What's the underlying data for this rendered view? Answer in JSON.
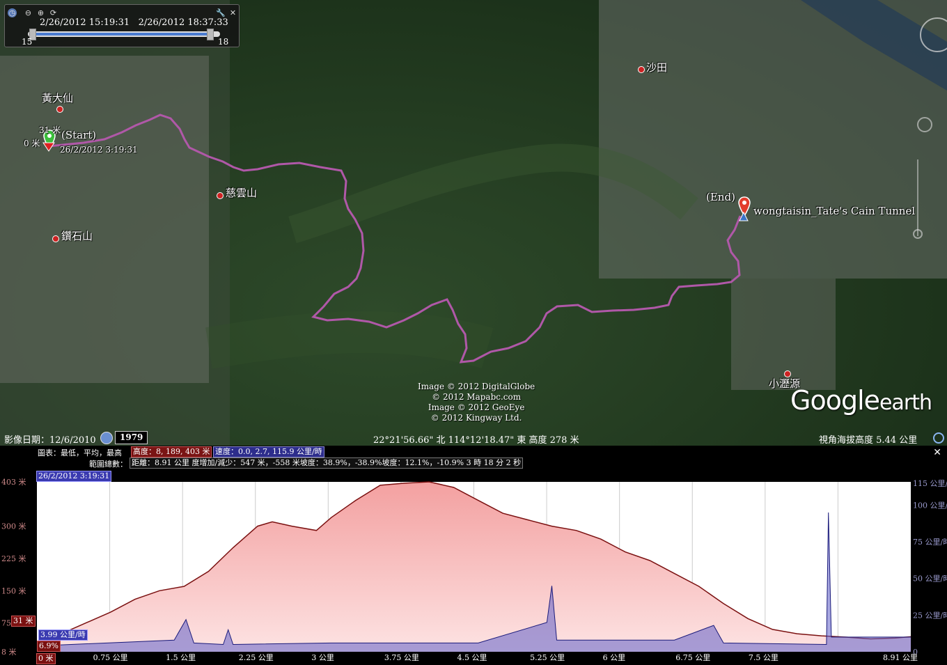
{
  "timeslider": {
    "start": "2/26/2012  15:19:31",
    "end": "2/26/2012  18:37:33",
    "min_label": "15",
    "max_label": "18"
  },
  "map": {
    "places": {
      "wongtaisin": "黃大仙",
      "tsz_wan_shan": "慈雲山",
      "diamond_hill": "鑽石山",
      "shatin": "沙田",
      "siu_lek_yuen": "小瀝源"
    },
    "start_marker": {
      "label": "(Start)",
      "elev": "31 米",
      "zero": "0 米",
      "time": "26/2/2012 3:19:31"
    },
    "end_marker": {
      "label": "(End)",
      "name": "wongtaisin_Tate's Cain Tunnel"
    },
    "copyright": [
      "Image © 2012 DigitalGlobe",
      "© 2012 Mapabc.com",
      "Image © 2012 GeoEye",
      "© 2012 Kingway Ltd."
    ],
    "logo_main": "Google",
    "logo_sub": "earth"
  },
  "status": {
    "imagery_date": "影像日期：12/6/2010",
    "year_badge": "1979",
    "coords": "22°21'56.66\" 北 114°12'18.47\" 東 高度   278 米",
    "eye_alt": "視角海拔高度     5.44 公里"
  },
  "profile": {
    "line1_label": "圖表：最低，平均，最高",
    "elev_box": "高度：8, 189, 403 米",
    "speed_box": "速度：0.0, 2.7, 115.9 公里/時",
    "line2_label": "範圍總數：",
    "stats_box": "距離：8.91 公里 度增加/減少：547 米，-558 米坡度：38.9%，-38.9%坡度：12.1%，-10.9% 3 時 18 分 2 秒",
    "cursor_time": "26/2/2012 3:19:31",
    "cursor_elev": "31 米",
    "cursor_speed": "3.99 公里/時",
    "cursor_grade": "6.9%",
    "cursor_x": "0 米",
    "elev_ticks": [
      "403 米",
      "300 米",
      "225 米",
      "150 米",
      "75 米",
      "8 米"
    ],
    "speed_ticks": [
      "115 公里/時",
      "100 公里/時",
      "75 公里/時",
      "50 公里/時",
      "25 公里/時",
      "0"
    ],
    "x_ticks": [
      "0 米",
      "0.75 公里",
      "1.5 公里",
      "2.25 公里",
      "3 公里",
      "3.75 公里",
      "4.5 公里",
      "5.25 公里",
      "6 公里",
      "6.75 公里",
      "7.5 公里",
      "8.91 公里"
    ]
  },
  "chart_data": {
    "type": "area",
    "title": "",
    "xlabel": "",
    "ylabel": "",
    "xlim": [
      0,
      8.91
    ],
    "ylim": [
      8,
      403
    ],
    "ylim_right": [
      0,
      115.9
    ],
    "series": [
      {
        "name": "高度",
        "color": "#7a1010",
        "x": [
          0,
          0.1,
          0.25,
          0.5,
          0.75,
          1.0,
          1.25,
          1.5,
          1.75,
          2.0,
          2.25,
          2.4,
          2.6,
          2.85,
          3.0,
          3.25,
          3.5,
          3.75,
          4.0,
          4.25,
          4.5,
          4.75,
          5.0,
          5.25,
          5.5,
          5.75,
          6.0,
          6.25,
          6.5,
          6.75,
          7.0,
          7.25,
          7.5,
          7.75,
          8.0,
          8.25,
          8.5,
          8.75,
          8.91
        ],
        "values": [
          31,
          35,
          50,
          75,
          100,
          130,
          150,
          160,
          195,
          250,
          300,
          310,
          300,
          290,
          320,
          360,
          395,
          400,
          403,
          390,
          360,
          330,
          315,
          300,
          290,
          270,
          240,
          220,
          190,
          160,
          120,
          85,
          60,
          50,
          45,
          42,
          38,
          40,
          43
        ]
      },
      {
        "name": "速度",
        "color": "#3b3b9b",
        "x": [
          0,
          1.4,
          1.52,
          1.6,
          1.9,
          1.95,
          2.0,
          3.0,
          4.5,
          5.2,
          5.25,
          5.3,
          6.5,
          6.9,
          6.95,
          7.0,
          8.05,
          8.07,
          8.1,
          8.91
        ],
        "values": [
          4,
          8,
          22,
          6,
          5,
          15,
          5,
          6,
          6,
          20,
          45,
          8,
          8,
          18,
          12,
          6,
          5,
          95,
          10,
          10
        ]
      }
    ],
    "grid": true,
    "legend": "top-left"
  }
}
